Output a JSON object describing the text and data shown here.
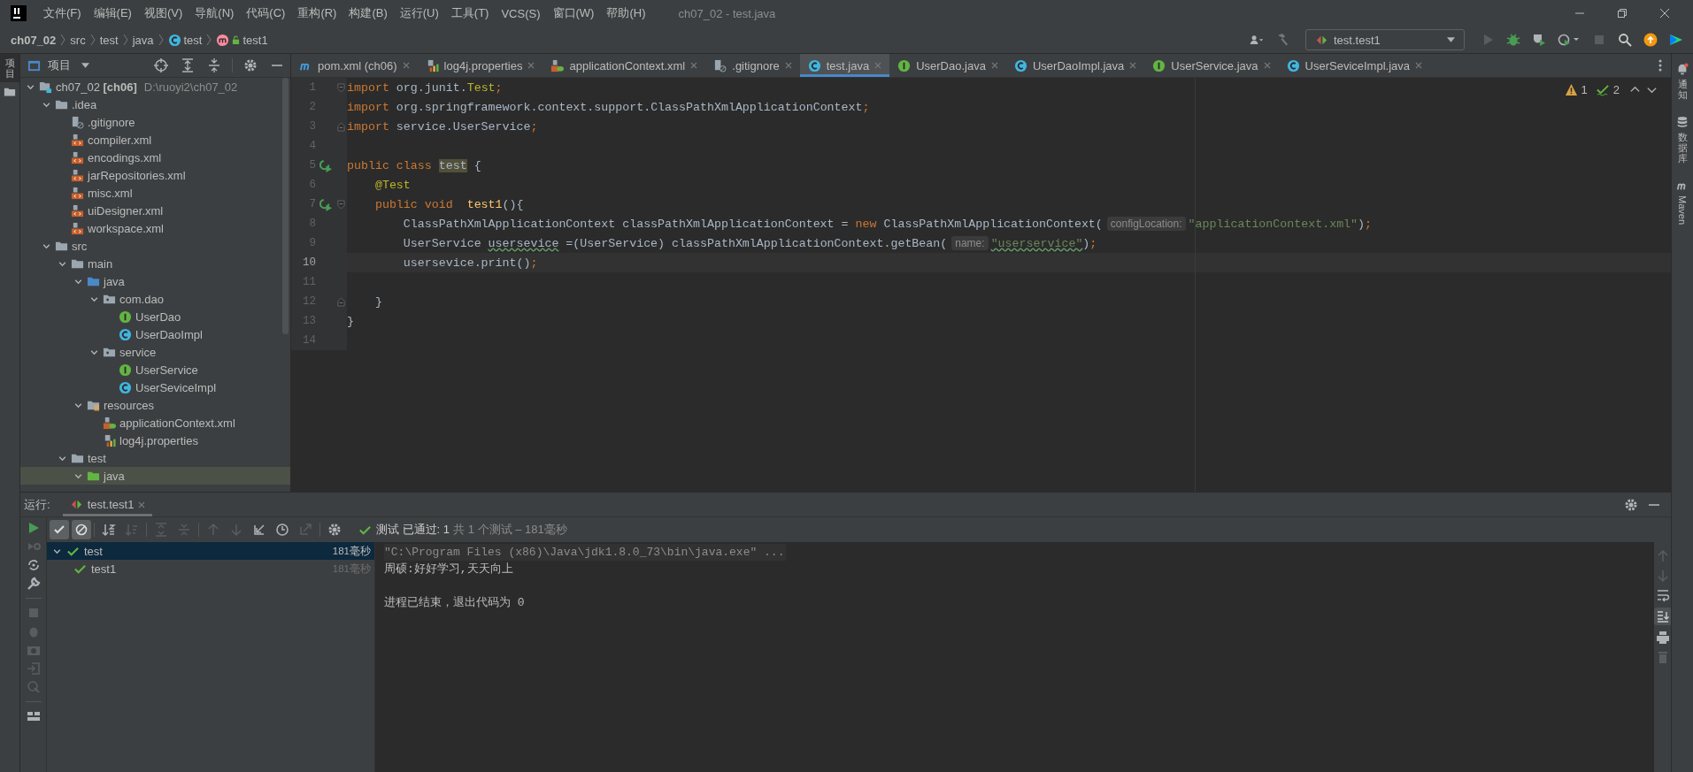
{
  "window": {
    "title": "ch07_02 - test.java"
  },
  "menu": [
    "文件(F)",
    "编辑(E)",
    "视图(V)",
    "导航(N)",
    "代码(C)",
    "重构(R)",
    "构建(B)",
    "运行(U)",
    "工具(T)",
    "VCS(S)",
    "窗口(W)",
    "帮助(H)"
  ],
  "breadcrumb": [
    {
      "label": "ch07_02",
      "kind": "project"
    },
    {
      "label": "src",
      "kind": "folder"
    },
    {
      "label": "test",
      "kind": "folder"
    },
    {
      "label": "java",
      "kind": "folder"
    },
    {
      "label": "test",
      "kind": "class"
    },
    {
      "label": "test1",
      "kind": "method"
    }
  ],
  "run_config": "test.test1",
  "left_stripe": [
    {
      "label": "项目",
      "selected": true
    }
  ],
  "right_stripe": [
    {
      "label": "通知",
      "kind": "notifications"
    },
    {
      "label": "数据库",
      "kind": "database"
    },
    {
      "label": "Maven",
      "kind": "maven"
    }
  ],
  "project_panel": {
    "title": "项目",
    "tree": [
      {
        "label": "ch07_02 **[ch06]**",
        "path": "D:\\ruoyi2\\ch07_02",
        "kind": "module",
        "expanded": true,
        "selected": false,
        "children": [
          {
            "label": ".idea",
            "kind": "folder",
            "expanded": true,
            "selected": false,
            "children": [
              {
                "label": ".gitignore",
                "kind": "ignore",
                "selected": false
              },
              {
                "label": "compiler.xml",
                "kind": "xml",
                "selected": false
              },
              {
                "label": "encodings.xml",
                "kind": "xml",
                "selected": false
              },
              {
                "label": "jarRepositories.xml",
                "kind": "xml",
                "selected": false
              },
              {
                "label": "misc.xml",
                "kind": "xml",
                "selected": false
              },
              {
                "label": "uiDesigner.xml",
                "kind": "xml",
                "selected": false
              },
              {
                "label": "workspace.xml",
                "kind": "xml",
                "selected": false
              }
            ]
          },
          {
            "label": "src",
            "kind": "folder",
            "expanded": true,
            "selected": false,
            "children": [
              {
                "label": "main",
                "kind": "folder",
                "expanded": true,
                "selected": false,
                "children": [
                  {
                    "label": "java",
                    "kind": "src-folder",
                    "expanded": true,
                    "selected": false,
                    "children": [
                      {
                        "label": "com.dao",
                        "kind": "package",
                        "expanded": true,
                        "selected": false,
                        "children": [
                          {
                            "label": "UserDao",
                            "kind": "interface",
                            "selected": false
                          },
                          {
                            "label": "UserDaoImpl",
                            "kind": "class",
                            "selected": false
                          }
                        ]
                      },
                      {
                        "label": "service",
                        "kind": "package",
                        "expanded": true,
                        "selected": false,
                        "children": [
                          {
                            "label": "UserService",
                            "kind": "interface",
                            "selected": false
                          },
                          {
                            "label": "UserSeviceImpl",
                            "kind": "class",
                            "selected": false
                          }
                        ]
                      }
                    ]
                  },
                  {
                    "label": "resources",
                    "kind": "res-folder",
                    "expanded": true,
                    "selected": false,
                    "children": [
                      {
                        "label": "applicationContext.xml",
                        "kind": "spring-xml",
                        "selected": false
                      },
                      {
                        "label": "log4j.properties",
                        "kind": "props",
                        "selected": false
                      }
                    ]
                  }
                ]
              },
              {
                "label": "test",
                "kind": "folder",
                "expanded": true,
                "selected": false,
                "children": [
                  {
                    "label": "java",
                    "kind": "test-folder",
                    "selected": true
                  }
                ]
              }
            ]
          }
        ]
      }
    ]
  },
  "editor": {
    "tabs": [
      {
        "label": "pom.xml (ch06)",
        "kind": "maven",
        "selected": false
      },
      {
        "label": "log4j.properties",
        "kind": "props",
        "selected": false
      },
      {
        "label": "applicationContext.xml",
        "kind": "spring-xml",
        "selected": false
      },
      {
        "label": ".gitignore",
        "kind": "ignore",
        "selected": false
      },
      {
        "label": "test.java",
        "kind": "class",
        "selected": true
      },
      {
        "label": "UserDao.java",
        "kind": "interface",
        "selected": false
      },
      {
        "label": "UserDaoImpl.java",
        "kind": "class",
        "selected": false
      },
      {
        "label": "UserService.java",
        "kind": "interface",
        "selected": false
      },
      {
        "label": "UserSeviceImpl.java",
        "kind": "class",
        "selected": false
      }
    ],
    "warnings": "1",
    "weak_warnings": "2",
    "lines": [
      {
        "number": "1",
        "fold_start": true,
        "fold_end": false,
        "run": false,
        "current": false,
        "tokens": [
          {
            "text": "import",
            "kind": "kw"
          },
          {
            "text": " org.junit.",
            "kind": "plain"
          },
          {
            "text": "Test",
            "kind": "ann"
          },
          {
            "text": ";",
            "kind": "kw"
          }
        ]
      },
      {
        "number": "2",
        "fold_start": false,
        "fold_end": false,
        "run": false,
        "current": false,
        "tokens": [
          {
            "text": "import",
            "kind": "kw"
          },
          {
            "text": " org.springframework.context.support.ClassPathXmlApplicationContext",
            "kind": "plain"
          },
          {
            "text": ";",
            "kind": "kw"
          }
        ]
      },
      {
        "number": "3",
        "fold_start": false,
        "fold_end": true,
        "run": false,
        "current": false,
        "tokens": [
          {
            "text": "import",
            "kind": "kw"
          },
          {
            "text": " service.UserService",
            "kind": "plain"
          },
          {
            "text": ";",
            "kind": "kw"
          }
        ]
      },
      {
        "number": "4",
        "fold_start": false,
        "fold_end": false,
        "run": false,
        "current": false
      },
      {
        "number": "5",
        "fold_start": false,
        "fold_end": false,
        "run": true,
        "current": false,
        "tokens": [
          {
            "text": "public class ",
            "kind": "kw"
          },
          {
            "text": "test",
            "kind": "hl"
          },
          {
            "text": " {",
            "kind": "plain"
          }
        ]
      },
      {
        "number": "6",
        "fold_start": false,
        "fold_end": false,
        "run": false,
        "current": false,
        "tokens": [
          {
            "text": "    @Test",
            "kind": "ann"
          }
        ]
      },
      {
        "number": "7",
        "fold_start": true,
        "fold_end": false,
        "run": true,
        "current": false,
        "tokens": [
          {
            "text": "    public void  ",
            "kind": "kw"
          },
          {
            "text": "test1",
            "kind": "fn"
          },
          {
            "text": "(){",
            "kind": "plain"
          }
        ]
      },
      {
        "number": "8",
        "fold_start": false,
        "fold_end": false,
        "run": false,
        "current": false,
        "tokens": [
          {
            "text": "        ClassPathXmlApplicationContext classPathXmlApplicationContext = ",
            "kind": "plain"
          },
          {
            "text": "new",
            "kind": "kw"
          },
          {
            "text": " ClassPathXmlApplicationContext(",
            "kind": "plain"
          },
          {
            "text": "configLocation:",
            "kind": "hint"
          },
          {
            "text": "\"applicationContext.xml\"",
            "kind": "str"
          },
          {
            "text": ")",
            "kind": "plain"
          },
          {
            "text": ";",
            "kind": "kw"
          }
        ]
      },
      {
        "number": "9",
        "fold_start": false,
        "fold_end": false,
        "run": false,
        "current": false,
        "tokens": [
          {
            "text": "        UserService ",
            "kind": "plain"
          },
          {
            "text": "usersevice",
            "kind": "typo"
          },
          {
            "text": " =(UserService) classPathXmlApplicationContext.getBean(",
            "kind": "plain"
          },
          {
            "text": "name:",
            "kind": "hint"
          },
          {
            "text": "\"userservice\"",
            "kind": "strtypo"
          },
          {
            "text": ")",
            "kind": "plain"
          },
          {
            "text": ";",
            "kind": "kw"
          }
        ]
      },
      {
        "number": "10",
        "fold_start": false,
        "fold_end": false,
        "run": false,
        "current": true,
        "tokens": [
          {
            "text": "        usersevice.print()",
            "kind": "plain"
          },
          {
            "text": ";",
            "kind": "kw"
          }
        ]
      },
      {
        "number": "11",
        "fold_start": false,
        "fold_end": false,
        "run": false,
        "current": false
      },
      {
        "number": "12",
        "fold_start": false,
        "fold_end": true,
        "run": false,
        "current": false,
        "tokens": [
          {
            "text": "    }",
            "kind": "plain"
          }
        ]
      },
      {
        "number": "13",
        "fold_start": false,
        "fold_end": false,
        "run": false,
        "current": false,
        "tokens": [
          {
            "text": "}",
            "kind": "plain"
          }
        ]
      },
      {
        "number": "14",
        "fold_start": false,
        "fold_end": false,
        "run": false,
        "current": false
      }
    ]
  },
  "run_panel": {
    "label": "运行:",
    "tab": "test.test1",
    "filters": [
      {
        "kind": "passed",
        "on": true
      },
      {
        "kind": "ignored",
        "on": true
      }
    ],
    "status": {
      "summary": "测试 已通过: 1",
      "detail": "共 1 个测试 – 181毫秒"
    },
    "tests": [
      {
        "name": "test",
        "time": "181毫秒",
        "selected": true,
        "expanded": true,
        "children": [
          {
            "name": "test1",
            "time": "181毫秒",
            "selected": false
          }
        ]
      }
    ],
    "console": [
      {
        "text": "\"C:\\Program Files (x86)\\Java\\jdk1.8.0_73\\bin\\java.exe\" ...",
        "kind": "command"
      },
      {
        "text": "周硕:好好学习,天天向上",
        "kind": "output"
      },
      {
        "text": "进程已结束，退出代码为 0",
        "kind": "exit"
      }
    ]
  }
}
